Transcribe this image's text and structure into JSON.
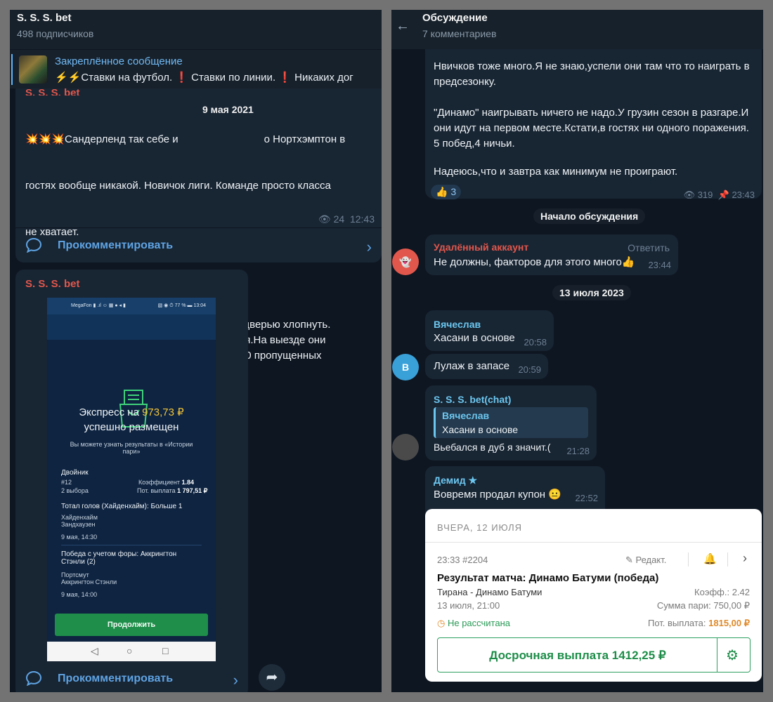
{
  "left": {
    "channel_title": "S. S. S. bet",
    "subscribers": "498 подписчиков",
    "pinned": {
      "title": "Закреплённое сообщение",
      "text": "⚡⚡Ставки на футбол. ❗ Ставки по линии. ❗ Никаких дог"
    },
    "post1": {
      "author": "S. S. S. bet",
      "date_pill": "9 мая 2021",
      "para1": "💥💥💥Сандерленд так себе и",
      "para1b": "о Нортхэмптон в",
      "para1c": "гостях вообще никакой. Новичок лиги. Команде просто класса",
      "para1d": "не хватает.",
      "para2": "Не знаю, захотят ли они напоследок громко дверью хлопнуть.\nНо даже если и захотят, то вряд ли получится.На выезде они\nпочти хуже всех... 22 матча, 13 поражений. 40 пропущенных\nголов.",
      "views": "24",
      "time": "12:43",
      "comment_label": "Прокомментировать"
    },
    "post2": {
      "author": "S. S. S. bet",
      "comment_label": "Прокомментировать",
      "phone": {
        "status_left": "MegaFon ▮ .ıl ☺ ▦ ● ◂ ▮",
        "status_right": "▧ ◉ ⏱ 77 % ▬ 13:04",
        "express_prefix": "Экспресс на ",
        "express_amount": "973,73 ₽",
        "express_suffix": "успешно размещен",
        "hint": "Вы можете узнать результаты в «Истории пари»",
        "dvoinik": "Двойник",
        "num": "#12",
        "vybora": "2 выбора",
        "koef_label": "Коэффициент",
        "koef": "1.84",
        "payout_label": "Пот. выплата",
        "payout": "1 797,51 ₽",
        "total": "Тотал голов (Хайденхайм): Больше 1",
        "team1": "Хайденхайм",
        "team2": "Зандхаузен",
        "date1": "9 мая, 14:30",
        "win": "Победа с учетом форы: Аккрингтон Стэнли (2)",
        "team3": "Портсмут",
        "team4": "Аккрингтон Стэнли",
        "date2": "9 мая, 14:00",
        "continue": "Продолжить"
      }
    }
  },
  "right": {
    "title": "Обсуждение",
    "subtitle": "7 комментариев",
    "post": {
      "line1": "Нвичков тоже много.Я не знаю,успели они там что то наиграть в",
      "line2": "предсезонку.",
      "line3": "\"Динамо\" наигрывать ничего не надо.У грузин сезон в разгаре.И",
      "line4": "они идут на первом месте.Кстати,в гостях ни одного поражения.",
      "line5": "5 побед,4 ничьи.",
      "line6": "Надеюсь,что и завтра как минимум не проиграют.",
      "reaction_emoji": "👍",
      "reaction_count": "3",
      "views": "319",
      "time": "23:43"
    },
    "discussion_start": "Начало обсуждения",
    "deleted": {
      "name": "Удалённый аккаунт",
      "reply": "Ответить",
      "text": "Не должны, факторов для этого много👍",
      "time": "23:44"
    },
    "date_pill": "13 июля 2023",
    "slava1": {
      "name": "Вячеслав",
      "text": "Хасани в основе",
      "time": "20:58"
    },
    "slava2": {
      "text": "Лулаж в запасе",
      "time": "20:59",
      "avatar": "В"
    },
    "chatmsg": {
      "name": "S. S. S. bet(chat)",
      "quote_name": "Вячеслав",
      "quote_text": "Хасани в основе",
      "text": "Вьебался в дуб я значит.(",
      "time": "21:28"
    },
    "demid": {
      "name": "Демид",
      "star": "★",
      "text": "Вовремя продал купон 😐",
      "time": "22:52"
    },
    "card": {
      "head": "ВЧЕРА, 12 ИЮЛЯ",
      "time_id": "23:33  #2204",
      "edit": "Редакт.",
      "title": "Результат матча: Динамо Батуми (победа)",
      "match": "Тирана - Динамо Батуми",
      "koef": "Коэфф.: 2.42",
      "date": "13 июля, 21:00",
      "stake": "Сумма пари: 750,00 ₽",
      "status": "Не рассчитана",
      "payout_label": "Пот. выплата:",
      "payout": "1815,00 ₽",
      "early_btn": "Досрочная выплата 1412,25 ₽"
    },
    "colors": {
      "deleted_name": "#e2574c",
      "name_blue": "#6cc7f0",
      "accent_green": "#1e8d49"
    }
  }
}
